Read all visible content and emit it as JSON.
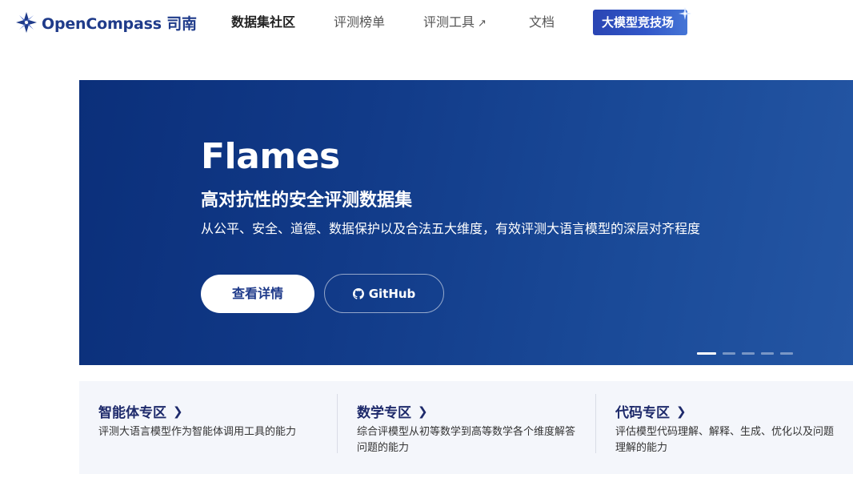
{
  "header": {
    "logo_text": "OpenCompass 司南",
    "nav": [
      {
        "label": "数据集社区",
        "active": true
      },
      {
        "label": "评测榜单",
        "active": false
      },
      {
        "label": "评测工具",
        "active": false,
        "external": true
      },
      {
        "label": "文档",
        "active": false
      }
    ],
    "external_icon": "↗",
    "arena_button": "大模型竞技场"
  },
  "banner": {
    "title": "Flames",
    "subtitle": "高对抗性的安全评测数据集",
    "description": "从公平、安全、道德、数据保护以及合法五大维度，有效评测大语言模型的深层对齐程度",
    "primary_button": "查看详情",
    "github_button": "GitHub",
    "carousel": {
      "count": 5,
      "active_index": 0
    }
  },
  "zones": [
    {
      "title": "智能体专区",
      "description": "评测大语言模型作为智能体调用工具的能力"
    },
    {
      "title": "数学专区",
      "description": "综合评模型从初等数学到高等数学各个维度解答问题的能力"
    },
    {
      "title": "代码专区",
      "description": "评估模型代码理解、解释、生成、优化以及问题理解的能力"
    }
  ],
  "icons": {
    "chevron": "chevron-right-icon",
    "github": "github-icon",
    "logo": "compass-logo-icon",
    "spark": "sparkle-icon"
  },
  "colors": {
    "brand": "#1f3b8a",
    "banner_start": "#0b2f7a",
    "banner_end": "#2456a4",
    "zone_bg": "#f4f6fb"
  }
}
